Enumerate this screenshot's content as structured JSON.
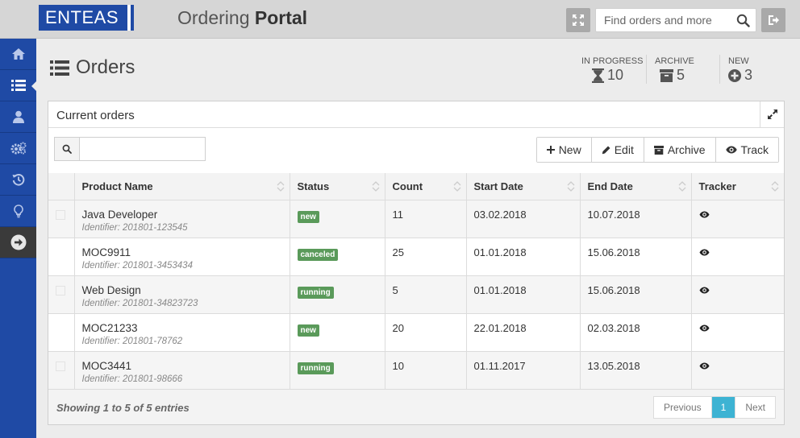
{
  "header": {
    "logo": "ENTEAS",
    "title_light": "Ordering ",
    "title_bold": "Portal",
    "search_placeholder": "Find orders and more"
  },
  "sidebar": {
    "items": [
      {
        "icon": "home-icon"
      },
      {
        "icon": "list-icon",
        "active": true
      },
      {
        "icon": "user-icon"
      },
      {
        "icon": "gears-icon"
      },
      {
        "icon": "history-icon"
      },
      {
        "icon": "lightbulb-icon"
      },
      {
        "icon": "arrow-right-circle-icon"
      }
    ]
  },
  "page": {
    "title": "Orders",
    "stats": {
      "in_progress": {
        "label": "IN PROGRESS",
        "value": "10"
      },
      "archive": {
        "label": "ARCHIVE",
        "value": "5"
      },
      "new": {
        "label": "NEW",
        "value": "3"
      }
    }
  },
  "panel": {
    "title": "Current orders",
    "filter_value": "",
    "actions": {
      "new": "New",
      "edit": "Edit",
      "archive": "Archive",
      "track": "Track"
    },
    "columns": [
      "Product Name",
      "Status",
      "Count",
      "Start Date",
      "End Date",
      "Tracker"
    ],
    "rows": [
      {
        "name": "Java Developer",
        "identifier": "Identifier: 201801-123545",
        "status": "new",
        "count": "11",
        "start": "03.02.2018",
        "end": "10.07.2018"
      },
      {
        "name": "MOC9911",
        "identifier": "Identifier: 201801-3453434",
        "status": "canceled",
        "count": "25",
        "start": "01.01.2018",
        "end": "15.06.2018"
      },
      {
        "name": "Web Design",
        "identifier": "Identifier: 201801-34823723",
        "status": "running",
        "count": "5",
        "start": "01.01.2018",
        "end": "15.06.2018"
      },
      {
        "name": "MOC21233",
        "identifier": "Identifier: 201801-78762",
        "status": "new",
        "count": "20",
        "start": "22.01.2018",
        "end": "02.03.2018"
      },
      {
        "name": "MOC3441",
        "identifier": "Identifier: 201801-98666",
        "status": "running",
        "count": "10",
        "start": "01.11.2017",
        "end": "13.05.2018"
      }
    ],
    "footer": {
      "info": "Showing 1 to 5 of 5 entries",
      "previous": "Previous",
      "current_page": "1",
      "next": "Next"
    }
  },
  "colors": {
    "brand": "#1f4aa5",
    "badge": "#5a9a5a",
    "pager_active": "#3db3d3"
  }
}
